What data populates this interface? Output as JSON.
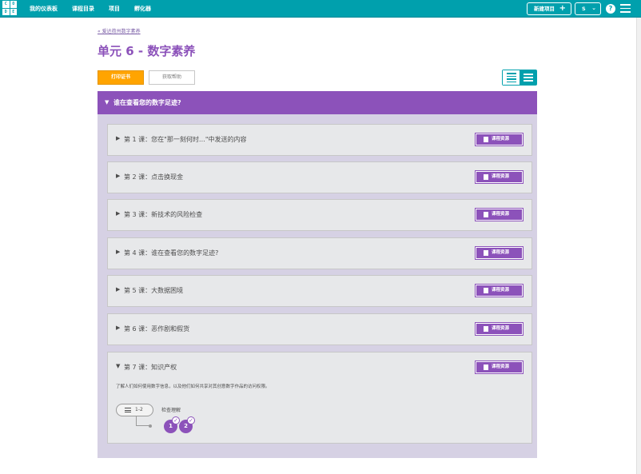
{
  "header": {
    "logo_letters": [
      "C",
      "O",
      "D",
      "E"
    ],
    "nav": [
      "我的仪表板",
      "课程目录",
      "项目",
      "孵化器"
    ],
    "new_project_label": "新建项目",
    "user_initial": "S",
    "help_label": "?"
  },
  "page": {
    "breadcrumb": "« 爱达荷州数字素养",
    "title": "单元 6 - 数字素养",
    "print_button": "打印证书",
    "help_button": "获取帮助"
  },
  "unit": {
    "title": "谁在查看您的数字足迹?",
    "resources_label": "课程资源",
    "lessons": [
      {
        "label": "第 1 课：您在\"那一刻何时…\"中发送的内容"
      },
      {
        "label": "第 2 课：点击换现金"
      },
      {
        "label": "第 3 课：新技术的风险检查"
      },
      {
        "label": "第 4 课：谁在查看您的数字足迹?"
      },
      {
        "label": "第 5 课：大数据困境"
      },
      {
        "label": "第 6 课：恶作剧和假货"
      },
      {
        "label": "第 7 课：知识产权",
        "description": "了解人们如何使用数字信息，以及他们如何共享对其创意数字作品的访问权限。",
        "level_range": "1-2",
        "activity_label": "检查理解",
        "bubbles": [
          "1",
          "2"
        ]
      }
    ]
  },
  "colors": {
    "header_teal": "#00a0ad",
    "unit_purple": "#8c52ba",
    "print_orange": "#ffa400",
    "panel_lavender": "#d6d1e4"
  }
}
